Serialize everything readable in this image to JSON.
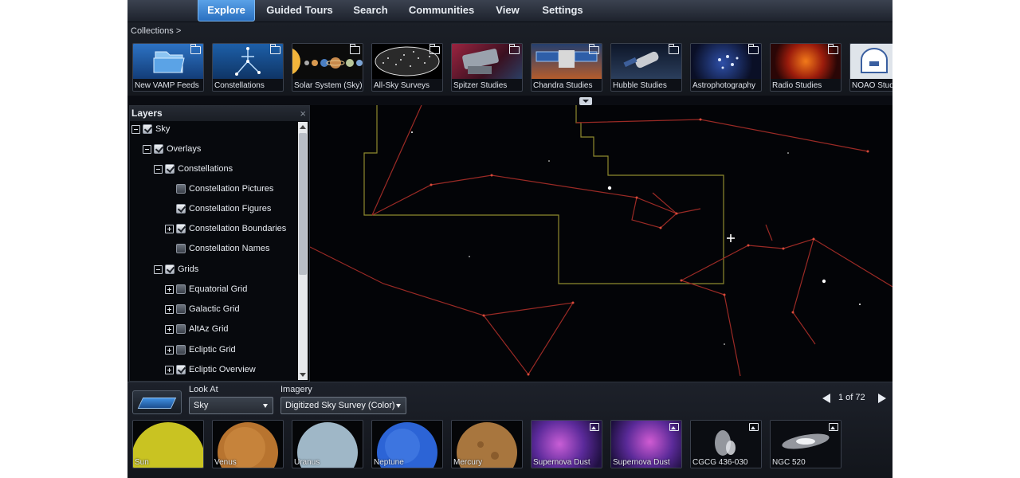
{
  "menu": {
    "items": [
      {
        "label": "Explore",
        "active": true
      },
      {
        "label": "Guided Tours",
        "active": false
      },
      {
        "label": "Search",
        "active": false
      },
      {
        "label": "Communities",
        "active": false
      },
      {
        "label": "View",
        "active": false
      },
      {
        "label": "Settings",
        "active": false
      }
    ]
  },
  "collections": {
    "label": "Collections >",
    "items": [
      {
        "label": "New VAMP Feeds",
        "icon": "folder-icon"
      },
      {
        "label": "Constellations",
        "icon": "folder-icon"
      },
      {
        "label": "Solar System (Sky)",
        "icon": "folder-icon"
      },
      {
        "label": "All-Sky Surveys",
        "icon": "folder-icon"
      },
      {
        "label": "Spitzer Studies",
        "icon": "folder-icon"
      },
      {
        "label": "Chandra Studies",
        "icon": "folder-icon"
      },
      {
        "label": "Hubble Studies",
        "icon": "folder-icon"
      },
      {
        "label": "Astrophotography",
        "icon": "folder-icon"
      },
      {
        "label": "Radio Studies",
        "icon": "folder-icon"
      },
      {
        "label": "NOAO Studi",
        "icon": "folder-icon"
      }
    ]
  },
  "layers": {
    "title": "Layers",
    "close_icon": "×",
    "items": [
      {
        "label": "Sky",
        "expander": "minus",
        "checked": true
      },
      {
        "label": "Overlays",
        "expander": "minus",
        "checked": true
      },
      {
        "label": "Constellations",
        "expander": "minus",
        "checked": true
      },
      {
        "label": "Constellation Pictures",
        "expander": "none",
        "checked": false
      },
      {
        "label": "Constellation Figures",
        "expander": "none",
        "checked": true
      },
      {
        "label": "Constellation Boundaries",
        "expander": "plus",
        "checked": true
      },
      {
        "label": "Constellation Names",
        "expander": "none",
        "checked": false
      },
      {
        "label": "Grids",
        "expander": "minus",
        "checked": true
      },
      {
        "label": "Equatorial Grid",
        "expander": "plus",
        "checked": false
      },
      {
        "label": "Galactic Grid",
        "expander": "plus",
        "checked": false
      },
      {
        "label": "AltAz Grid",
        "expander": "plus",
        "checked": false
      },
      {
        "label": "Ecliptic Grid",
        "expander": "plus",
        "checked": false
      },
      {
        "label": "Ecliptic Overview",
        "expander": "plus",
        "checked": true
      }
    ]
  },
  "bottom": {
    "look_at_label": "Look At",
    "look_at_value": "Sky",
    "imagery_label": "Imagery",
    "imagery_value": "Digitized Sky Survey (Color)",
    "pager_text": "1 of 72",
    "items": [
      {
        "label": "Sun",
        "icon": ""
      },
      {
        "label": "Venus",
        "icon": ""
      },
      {
        "label": "Uranus",
        "icon": ""
      },
      {
        "label": "Neptune",
        "icon": ""
      },
      {
        "label": "Mercury",
        "icon": ""
      },
      {
        "label": "Supernova Dust",
        "icon": "image-icon"
      },
      {
        "label": "Supernova Dust",
        "icon": "image-icon"
      },
      {
        "label": "CGCG 436-030",
        "icon": "image-icon"
      },
      {
        "label": "NGC 520",
        "icon": "image-icon"
      }
    ]
  },
  "colors": {
    "accent": "#3a86d6",
    "constellation_lines": "#c0392b",
    "boundary_lines": "#8f8a2e",
    "background": "#05060a"
  }
}
